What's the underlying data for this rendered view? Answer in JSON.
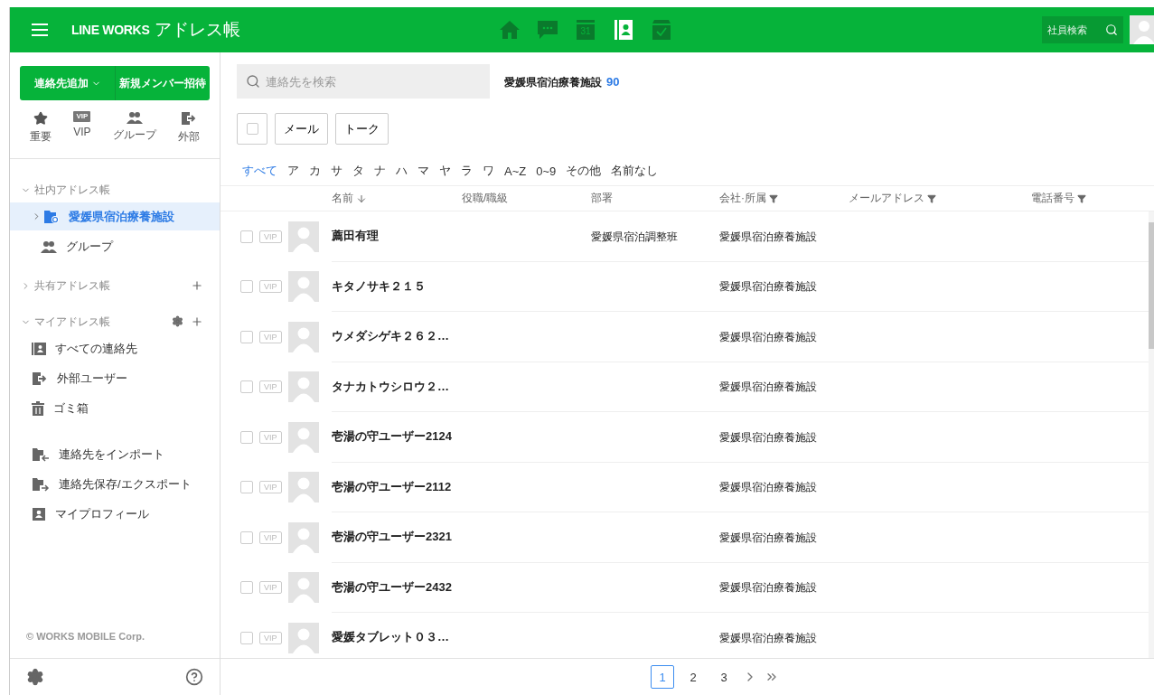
{
  "header": {
    "brand": "LINE WORKS",
    "app_title": "アドレス帳",
    "nav": [
      {
        "kind": "home",
        "selected": false
      },
      {
        "kind": "chat",
        "selected": false
      },
      {
        "kind": "calendar",
        "label": "31",
        "selected": false
      },
      {
        "kind": "contacts",
        "selected": true
      },
      {
        "kind": "tasks",
        "selected": false
      }
    ],
    "employee_search": {
      "placeholder": "社員検索"
    }
  },
  "sidebar": {
    "add_button": "連絡先追加",
    "invite_button": "新規メンバー招待",
    "shortcuts": [
      {
        "kind": "star",
        "label": "重要"
      },
      {
        "kind": "vip",
        "badge": "VIP",
        "label": "VIP"
      },
      {
        "kind": "group",
        "label": "グループ"
      },
      {
        "kind": "external",
        "label": "外部"
      }
    ],
    "sections": [
      {
        "title": "社内アドレス帳",
        "expanded": true,
        "children": [
          {
            "kind": "folder",
            "label": "愛媛県宿泊療養施設",
            "selected": true,
            "expanded": false
          },
          {
            "kind": "group",
            "label": "グループ",
            "selected": false
          }
        ]
      },
      {
        "title": "共有アドレス帳",
        "expanded": false,
        "add": true
      },
      {
        "title": "マイアドレス帳",
        "expanded": true,
        "settings": true,
        "add": true,
        "children": [
          {
            "kind": "contacts",
            "label": "すべての連絡先",
            "selected": false
          },
          {
            "kind": "external",
            "label": "外部ユーザー",
            "selected": false
          },
          {
            "kind": "trash",
            "label": "ゴミ箱",
            "selected": false
          }
        ]
      }
    ],
    "tools": [
      {
        "kind": "import",
        "label": "連絡先をインポート"
      },
      {
        "kind": "export",
        "label": "連絡先保存/エクスポート"
      },
      {
        "kind": "profile",
        "label": "マイプロフィール"
      }
    ],
    "copyright": "© WORKS MOBILE Corp."
  },
  "main": {
    "search": {
      "placeholder": "連絡先を検索"
    },
    "folder_title": "愛媛県宿泊療養施設",
    "count": "90",
    "select_all": {
      "checked": false
    },
    "actions": [
      "メール",
      "トーク"
    ],
    "index": [
      {
        "label": "すべて",
        "selected": true
      },
      {
        "label": "ア",
        "selected": false
      },
      {
        "label": "カ",
        "selected": false
      },
      {
        "label": "サ",
        "selected": false
      },
      {
        "label": "タ",
        "selected": false
      },
      {
        "label": "ナ",
        "selected": false
      },
      {
        "label": "ハ",
        "selected": false
      },
      {
        "label": "マ",
        "selected": false
      },
      {
        "label": "ヤ",
        "selected": false
      },
      {
        "label": "ラ",
        "selected": false
      },
      {
        "label": "ワ",
        "selected": false
      },
      {
        "label": "A~Z",
        "selected": false
      },
      {
        "label": "0~9",
        "selected": false
      },
      {
        "label": "その他",
        "selected": false
      },
      {
        "label": "名前なし",
        "selected": false
      }
    ],
    "columns": [
      {
        "label": "名前",
        "sorted": true,
        "filter": false
      },
      {
        "label": "役職/職級",
        "sorted": false,
        "filter": false
      },
      {
        "label": "部署",
        "sorted": false,
        "filter": false
      },
      {
        "label": "会社·所属",
        "sorted": false,
        "filter": true
      },
      {
        "label": "メールアドレス",
        "sorted": false,
        "filter": true
      },
      {
        "label": "電話番号",
        "sorted": false,
        "filter": true
      }
    ],
    "rows": [
      {
        "checked": false,
        "vip": {
          "label": "VIP",
          "on": false
        },
        "name": "薦田有理",
        "department": "愛媛県宿泊調整班",
        "company": "愛媛県宿泊療養施設"
      },
      {
        "checked": false,
        "vip": {
          "label": "VIP",
          "on": false
        },
        "name": "キタノサキ２１５",
        "company": "愛媛県宿泊療養施設"
      },
      {
        "checked": false,
        "vip": {
          "label": "VIP",
          "on": false
        },
        "name": "ウメダシゲキ２６２…",
        "company": "愛媛県宿泊療養施設"
      },
      {
        "checked": false,
        "vip": {
          "label": "VIP",
          "on": false
        },
        "name": "タナカトウシロウ２…",
        "company": "愛媛県宿泊療養施設"
      },
      {
        "checked": false,
        "vip": {
          "label": "VIP",
          "on": false
        },
        "name": "壱湯の守ユーザー2124",
        "company": "愛媛県宿泊療養施設"
      },
      {
        "checked": false,
        "vip": {
          "label": "VIP",
          "on": false
        },
        "name": "壱湯の守ユーザー2112",
        "company": "愛媛県宿泊療養施設"
      },
      {
        "checked": false,
        "vip": {
          "label": "VIP",
          "on": false
        },
        "name": "壱湯の守ユーザー2321",
        "company": "愛媛県宿泊療養施設"
      },
      {
        "checked": false,
        "vip": {
          "label": "VIP",
          "on": false
        },
        "name": "壱湯の守ユーザー2432",
        "company": "愛媛県宿泊療養施設"
      },
      {
        "checked": false,
        "vip": {
          "label": "VIP",
          "on": false
        },
        "name": "愛媛タブレット０３…",
        "company": "愛媛県宿泊療養施設"
      }
    ],
    "pagination": {
      "pages": [
        {
          "label": "1",
          "selected": true
        },
        {
          "label": "2",
          "selected": false
        },
        {
          "label": "3",
          "selected": false
        }
      ],
      "next": true,
      "last": true
    }
  }
}
